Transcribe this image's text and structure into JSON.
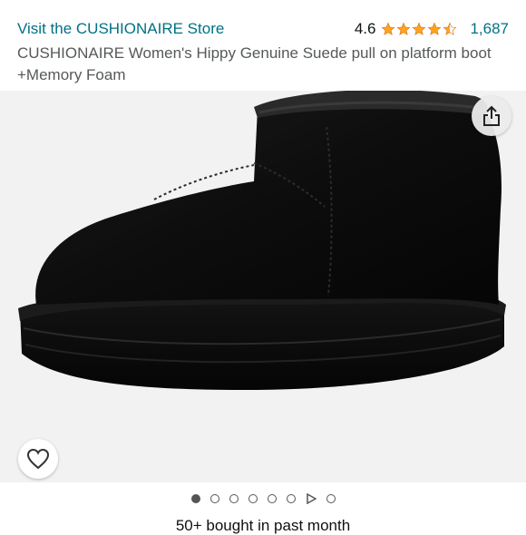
{
  "store": {
    "link_text": "Visit the CUSHIONAIRE Store"
  },
  "rating": {
    "value": "4.6",
    "stars": 4.5,
    "count": "1,687",
    "star_color": "#ffa41c"
  },
  "product": {
    "title": "CUSHIONAIRE Women's Hippy Genuine Suede pull on platform boot +Memory Foam"
  },
  "image": {
    "icons": {
      "share": "share-icon",
      "wishlist": "heart-icon"
    }
  },
  "carousel": {
    "total_items": 8,
    "active_index": 0,
    "video_index": 6
  },
  "social_proof": {
    "text": "50+ bought in past month"
  },
  "colors": {
    "link": "#007185",
    "title": "#565959",
    "image_bg": "#f2f2f2"
  }
}
